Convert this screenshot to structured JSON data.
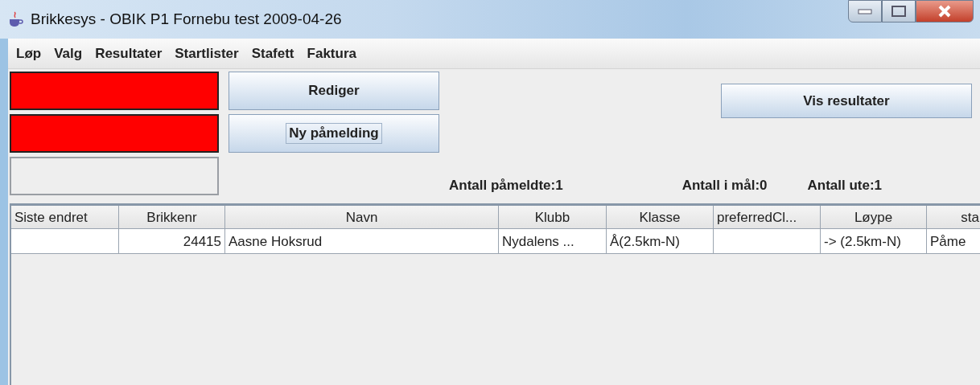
{
  "window": {
    "title": "Brikkesys - OBIK P1 Fornebu test 2009-04-26"
  },
  "menu": [
    "Løp",
    "Valg",
    "Resultater",
    "Startlister",
    "Stafett",
    "Faktura"
  ],
  "status_fields": [
    {
      "color": "#ff0000"
    },
    {
      "color": "#ff0000"
    },
    {
      "color": "#eeeeee"
    }
  ],
  "buttons": [
    {
      "label": "Rediger",
      "focused": false
    },
    {
      "label": "Ny påmelding",
      "focused": true
    }
  ],
  "results_button": "Vis resultater",
  "counts": [
    "Antall påmeldte:1",
    "Antall i mål:0",
    "Antall ute:1"
  ],
  "table": {
    "columns": [
      "Siste endret",
      "Brikkenr",
      "Navn",
      "Klubb",
      "Klasse",
      "preferredCl...",
      "Løype",
      "sta"
    ],
    "rows": [
      [
        "",
        "24415",
        "Aasne Hoksrud",
        "Nydalens ...",
        "Å(2.5km-N)",
        "",
        "-> (2.5km-N)",
        "Påme"
      ]
    ]
  }
}
